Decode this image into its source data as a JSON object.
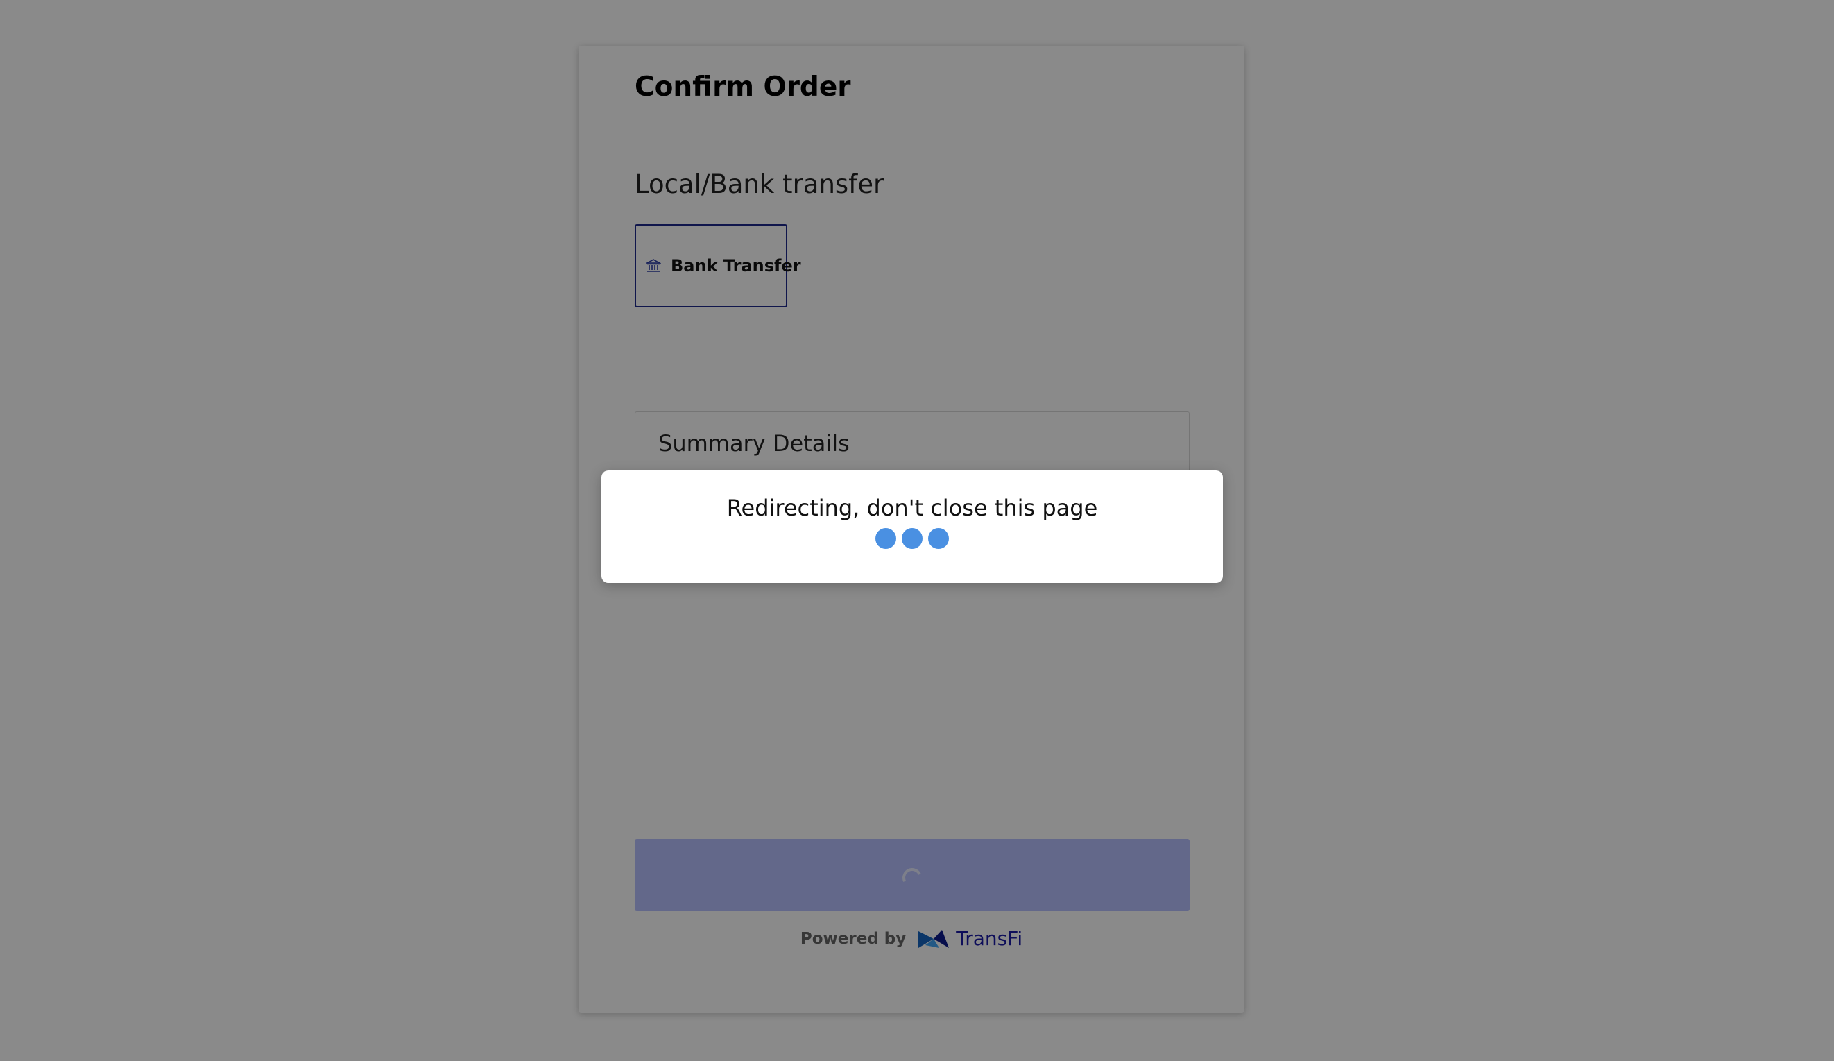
{
  "page": {
    "title": "Confirm Order"
  },
  "payment": {
    "section_title": "Local/Bank transfer",
    "method_label": "Bank Transfer",
    "method_icon": "bank-icon"
  },
  "summary": {
    "title": "Summary Details"
  },
  "confirm_button": {
    "state": "loading",
    "icon": "spinner-icon"
  },
  "footer": {
    "powered_by": "Powered by",
    "brand_name": "TransFi",
    "brand_icon": "transfi-logo-icon"
  },
  "modal": {
    "message": "Redirecting, don't close this page",
    "loader_dots": 3,
    "dot_color": "#4a90e2"
  },
  "colors": {
    "accent": "#1f2a8c",
    "button": "#b7c1ff",
    "brand": "#1a1aa6",
    "overlay": "rgba(0,0,0,0.46)"
  }
}
